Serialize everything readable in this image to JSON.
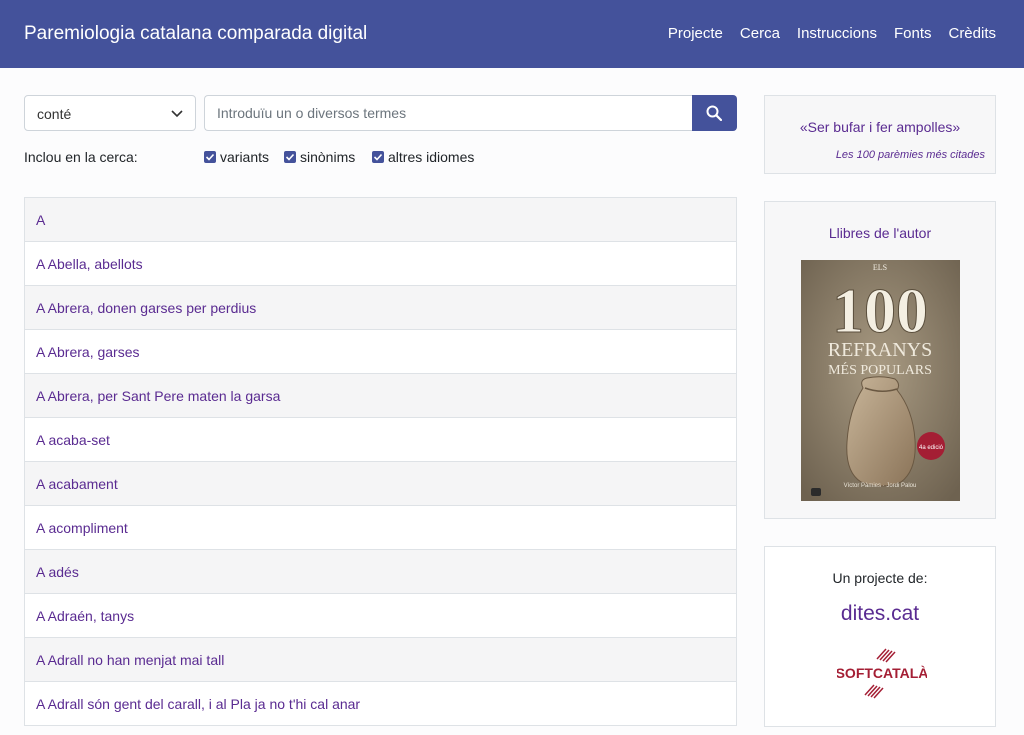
{
  "header": {
    "brand": "Paremiologia catalana comparada digital",
    "nav": [
      "Projecte",
      "Cerca",
      "Instruccions",
      "Fonts",
      "Crèdits"
    ]
  },
  "search": {
    "mode": "conté",
    "placeholder": "Introduïu un o diversos termes",
    "include_label": "Inclou en la cerca:",
    "options": [
      {
        "label": "variants",
        "checked": true
      },
      {
        "label": "sinònims",
        "checked": true
      },
      {
        "label": "altres idiomes",
        "checked": true
      }
    ]
  },
  "results": [
    "A",
    "A Abella, abellots",
    "A Abrera, donen garses per perdius",
    "A Abrera, garses",
    "A Abrera, per Sant Pere maten la garsa",
    "A acaba-set",
    "A acabament",
    "A acompliment",
    "A adés",
    "A Adraén, tanys",
    "A Adrall no han menjat mai tall",
    "A Adrall són gent del carall, i al Pla ja no t'hi cal anar"
  ],
  "sidebar": {
    "featured": {
      "title": "«Ser bufar i fer ampolles»",
      "subtitle": "Les 100 parèmies més citades"
    },
    "books": {
      "title": "Llibres de l'autor",
      "cover": {
        "top": "ELS",
        "number": "100",
        "line1": "REFRANYS",
        "line2": "MÉS POPULARS",
        "badge": "4a edició",
        "authors": "Víctor Pàmies · Jordi Palou"
      }
    },
    "project": {
      "title": "Un projecte de:",
      "site": "dites.cat",
      "org": "SOFTCATALÀ"
    }
  },
  "colors": {
    "header": "#44529b",
    "link": "#5a2b91",
    "accent": "#a41e34"
  }
}
